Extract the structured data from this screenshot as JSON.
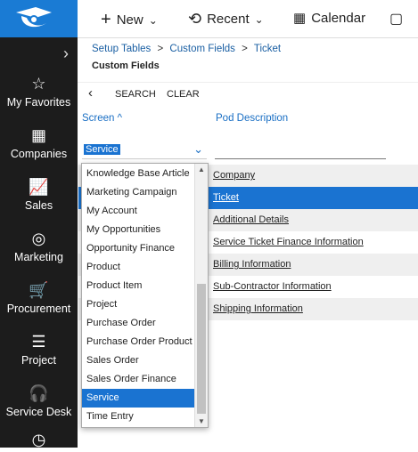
{
  "topbar": {
    "new": "New",
    "recent": "Recent",
    "calendar": "Calendar"
  },
  "sidebar": {
    "items": [
      {
        "label": "My Favorites",
        "icon": "star-icon"
      },
      {
        "label": "Companies",
        "icon": "building-icon"
      },
      {
        "label": "Sales",
        "icon": "chart-icon"
      },
      {
        "label": "Marketing",
        "icon": "target-icon"
      },
      {
        "label": "Procurement",
        "icon": "cart-icon"
      },
      {
        "label": "Project",
        "icon": "project-icon"
      },
      {
        "label": "Service Desk",
        "icon": "headset-icon"
      }
    ]
  },
  "breadcrumb": {
    "item1": "Setup Tables",
    "item2": "Custom Fields",
    "item3": "Ticket",
    "sep": ">"
  },
  "page_title": "Custom Fields",
  "toolbar": {
    "search": "SEARCH",
    "clear": "CLEAR"
  },
  "table": {
    "col_screen": "Screen",
    "col_pod": "Pod Description",
    "filter_screen": "Service",
    "rows": [
      "Company",
      "Ticket",
      "Additional Details",
      "Service Ticket Finance Information",
      "Billing Information",
      "Sub-Contractor Information",
      "Shipping Information"
    ]
  },
  "dropdown": {
    "options": [
      "Knowledge Base Article",
      "Marketing Campaign",
      "My Account",
      "My Opportunities",
      "Opportunity Finance",
      "Product",
      "Product Item",
      "Project",
      "Purchase Order",
      "Purchase Order Product",
      "Sales Order",
      "Sales Order Finance",
      "Service",
      "Time Entry"
    ],
    "selected": "Service"
  },
  "colors": {
    "brand": "#1a7bd4",
    "sidebar": "#1c1c1c",
    "selection": "#1a73d1",
    "link": "#1a5fa3"
  }
}
